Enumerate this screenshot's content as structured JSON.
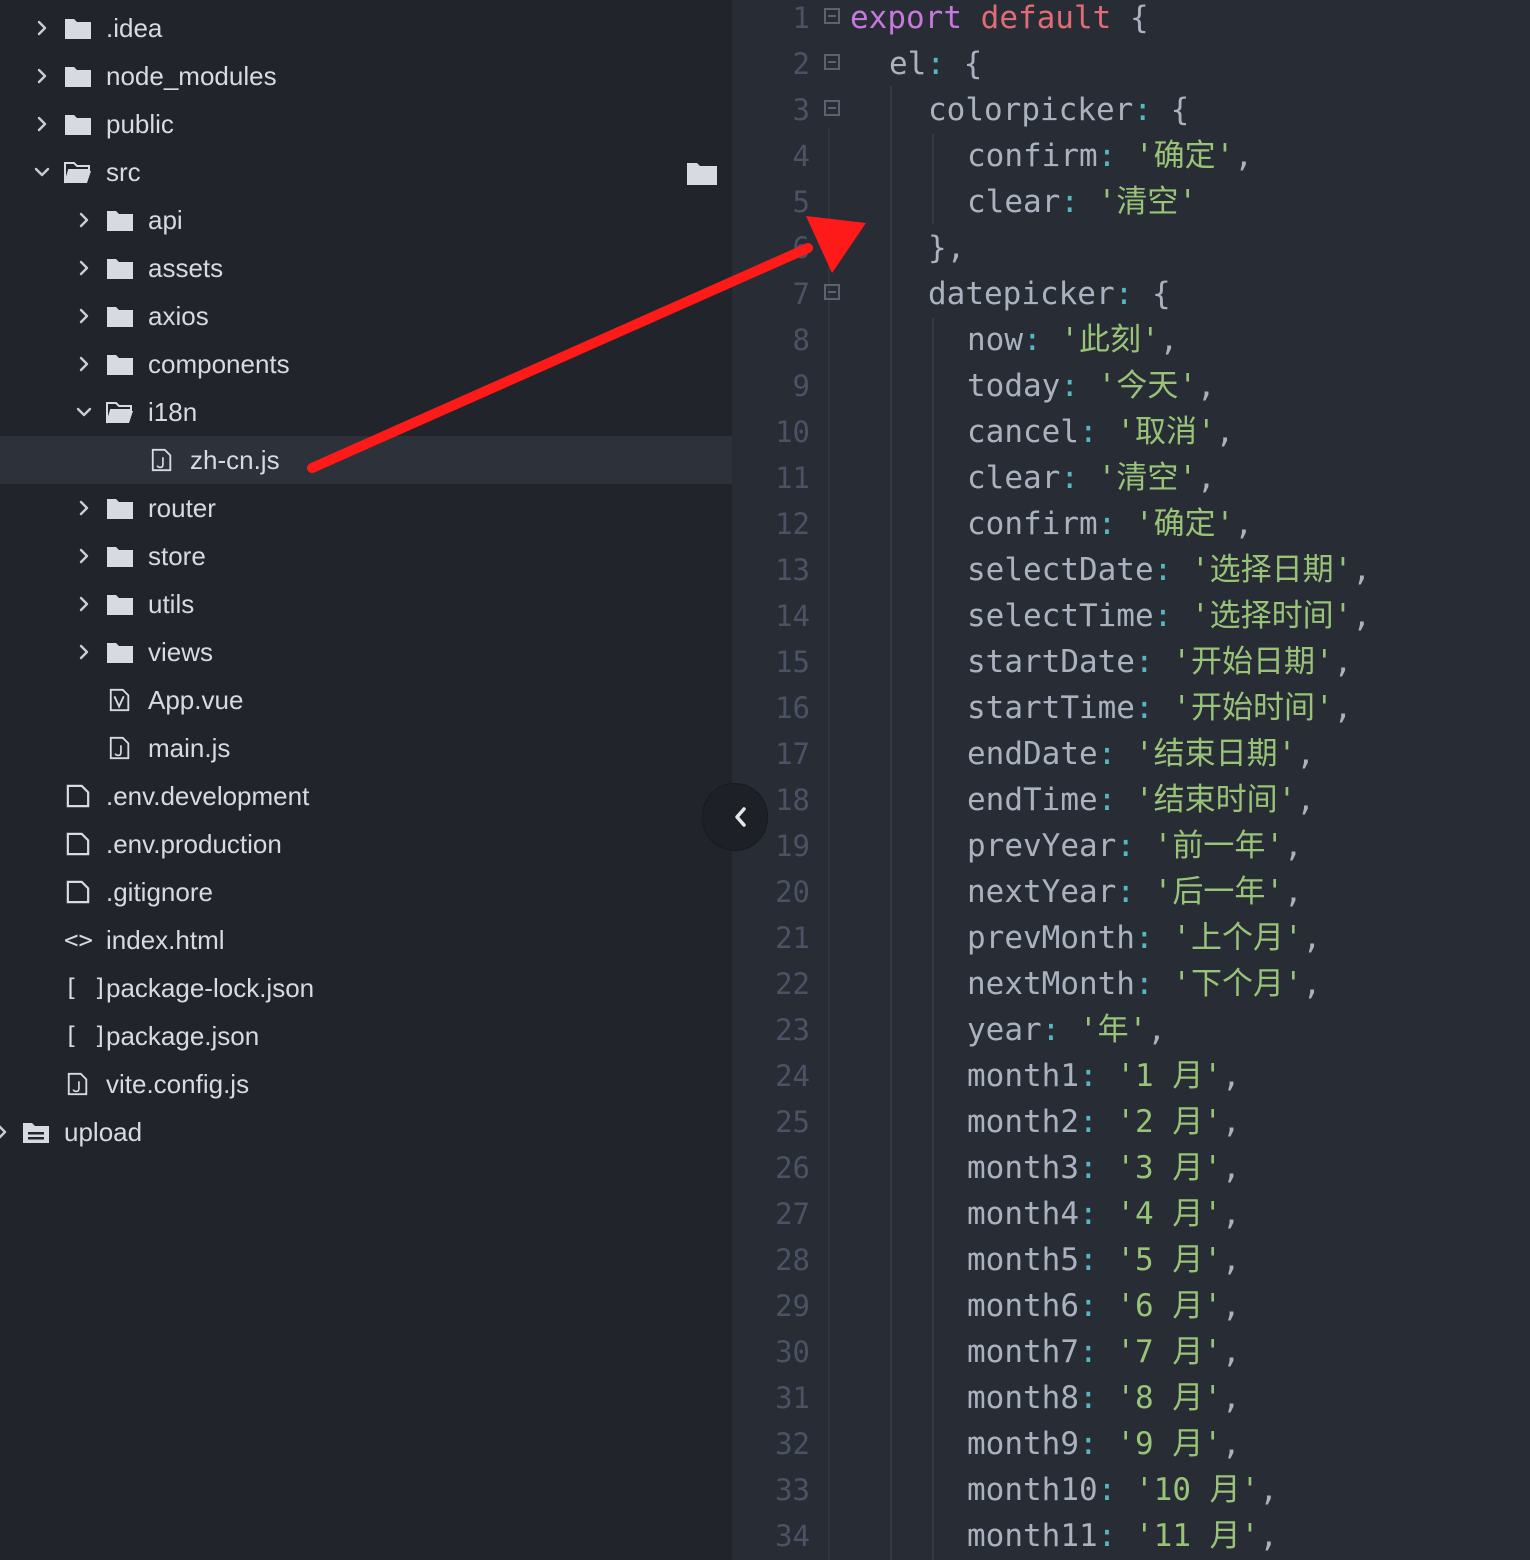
{
  "sidebar": {
    "items": [
      {
        "label": ".idea",
        "kind": "folder",
        "depth": 1,
        "expanded": false
      },
      {
        "label": "node_modules",
        "kind": "folder",
        "depth": 1,
        "expanded": false
      },
      {
        "label": "public",
        "kind": "folder",
        "depth": 1,
        "expanded": false
      },
      {
        "label": "src",
        "kind": "folder",
        "depth": 1,
        "expanded": true
      },
      {
        "label": "api",
        "kind": "folder",
        "depth": 2,
        "expanded": false
      },
      {
        "label": "assets",
        "kind": "folder",
        "depth": 2,
        "expanded": false
      },
      {
        "label": "axios",
        "kind": "folder",
        "depth": 2,
        "expanded": false
      },
      {
        "label": "components",
        "kind": "folder",
        "depth": 2,
        "expanded": false
      },
      {
        "label": "i18n",
        "kind": "folder",
        "depth": 2,
        "expanded": true
      },
      {
        "label": "zh-cn.js",
        "kind": "js-file",
        "depth": 3,
        "selected": true
      },
      {
        "label": "router",
        "kind": "folder",
        "depth": 2,
        "expanded": false
      },
      {
        "label": "store",
        "kind": "folder",
        "depth": 2,
        "expanded": false
      },
      {
        "label": "utils",
        "kind": "folder",
        "depth": 2,
        "expanded": false
      },
      {
        "label": "views",
        "kind": "folder",
        "depth": 2,
        "expanded": false
      },
      {
        "label": "App.vue",
        "kind": "vue-file",
        "depth": 2
      },
      {
        "label": "main.js",
        "kind": "js-file",
        "depth": 2
      },
      {
        "label": ".env.development",
        "kind": "file",
        "depth": 1
      },
      {
        "label": ".env.production",
        "kind": "file",
        "depth": 1
      },
      {
        "label": ".gitignore",
        "kind": "file",
        "depth": 1
      },
      {
        "label": "index.html",
        "kind": "html-file",
        "depth": 1,
        "symbol": "<>"
      },
      {
        "label": "package-lock.json",
        "kind": "json-file",
        "depth": 1,
        "symbol": "[ ]"
      },
      {
        "label": "package.json",
        "kind": "json-file",
        "depth": 1,
        "symbol": "[ ]"
      },
      {
        "label": "vite.config.js",
        "kind": "js-file",
        "depth": 1
      },
      {
        "label": "upload",
        "kind": "upload-folder",
        "depth": 0,
        "expanded": false
      }
    ]
  },
  "editor": {
    "lines": [
      {
        "n": "1",
        "fold": true,
        "indent": 0,
        "tokens": [
          [
            "kw",
            "export"
          ],
          [
            "p",
            " "
          ],
          [
            "def",
            "default"
          ],
          [
            "p",
            " {"
          ]
        ]
      },
      {
        "n": "2",
        "fold": true,
        "indent": 1,
        "tokens": [
          [
            "k",
            "el"
          ],
          [
            "c",
            ":"
          ],
          [
            "p",
            " {"
          ]
        ]
      },
      {
        "n": "3",
        "fold": true,
        "indent": 2,
        "tokens": [
          [
            "k",
            "colorpicker"
          ],
          [
            "c",
            ":"
          ],
          [
            "p",
            " {"
          ]
        ]
      },
      {
        "n": "4",
        "indent": 3,
        "tokens": [
          [
            "k",
            "confirm"
          ],
          [
            "c",
            ":"
          ],
          [
            "p",
            " "
          ],
          [
            "s",
            "'确定'"
          ],
          [
            "p",
            ","
          ]
        ]
      },
      {
        "n": "5",
        "indent": 3,
        "tokens": [
          [
            "k",
            "clear"
          ],
          [
            "c",
            ":"
          ],
          [
            "p",
            " "
          ],
          [
            "s",
            "'清空'"
          ]
        ]
      },
      {
        "n": "6",
        "indent": 2,
        "tokens": [
          [
            "p",
            "},"
          ]
        ]
      },
      {
        "n": "7",
        "fold": true,
        "indent": 2,
        "tokens": [
          [
            "k",
            "datepicker"
          ],
          [
            "c",
            ":"
          ],
          [
            "p",
            " {"
          ]
        ]
      },
      {
        "n": "8",
        "indent": 3,
        "tokens": [
          [
            "k",
            "now"
          ],
          [
            "c",
            ":"
          ],
          [
            "p",
            " "
          ],
          [
            "s",
            "'此刻'"
          ],
          [
            "p",
            ","
          ]
        ]
      },
      {
        "n": "9",
        "indent": 3,
        "tokens": [
          [
            "k",
            "today"
          ],
          [
            "c",
            ":"
          ],
          [
            "p",
            " "
          ],
          [
            "s",
            "'今天'"
          ],
          [
            "p",
            ","
          ]
        ]
      },
      {
        "n": "10",
        "indent": 3,
        "tokens": [
          [
            "k",
            "cancel"
          ],
          [
            "c",
            ":"
          ],
          [
            "p",
            " "
          ],
          [
            "s",
            "'取消'"
          ],
          [
            "p",
            ","
          ]
        ]
      },
      {
        "n": "11",
        "indent": 3,
        "tokens": [
          [
            "k",
            "clear"
          ],
          [
            "c",
            ":"
          ],
          [
            "p",
            " "
          ],
          [
            "s",
            "'清空'"
          ],
          [
            "p",
            ","
          ]
        ]
      },
      {
        "n": "12",
        "indent": 3,
        "tokens": [
          [
            "k",
            "confirm"
          ],
          [
            "c",
            ":"
          ],
          [
            "p",
            " "
          ],
          [
            "s",
            "'确定'"
          ],
          [
            "p",
            ","
          ]
        ]
      },
      {
        "n": "13",
        "indent": 3,
        "tokens": [
          [
            "k",
            "selectDate"
          ],
          [
            "c",
            ":"
          ],
          [
            "p",
            " "
          ],
          [
            "s",
            "'选择日期'"
          ],
          [
            "p",
            ","
          ]
        ]
      },
      {
        "n": "14",
        "indent": 3,
        "tokens": [
          [
            "k",
            "selectTime"
          ],
          [
            "c",
            ":"
          ],
          [
            "p",
            " "
          ],
          [
            "s",
            "'选择时间'"
          ],
          [
            "p",
            ","
          ]
        ]
      },
      {
        "n": "15",
        "indent": 3,
        "tokens": [
          [
            "k",
            "startDate"
          ],
          [
            "c",
            ":"
          ],
          [
            "p",
            " "
          ],
          [
            "s",
            "'开始日期'"
          ],
          [
            "p",
            ","
          ]
        ]
      },
      {
        "n": "16",
        "indent": 3,
        "tokens": [
          [
            "k",
            "startTime"
          ],
          [
            "c",
            ":"
          ],
          [
            "p",
            " "
          ],
          [
            "s",
            "'开始时间'"
          ],
          [
            "p",
            ","
          ]
        ]
      },
      {
        "n": "17",
        "indent": 3,
        "tokens": [
          [
            "k",
            "endDate"
          ],
          [
            "c",
            ":"
          ],
          [
            "p",
            " "
          ],
          [
            "s",
            "'结束日期'"
          ],
          [
            "p",
            ","
          ]
        ]
      },
      {
        "n": "18",
        "indent": 3,
        "tokens": [
          [
            "k",
            "endTime"
          ],
          [
            "c",
            ":"
          ],
          [
            "p",
            " "
          ],
          [
            "s",
            "'结束时间'"
          ],
          [
            "p",
            ","
          ]
        ]
      },
      {
        "n": "19",
        "indent": 3,
        "tokens": [
          [
            "k",
            "prevYear"
          ],
          [
            "c",
            ":"
          ],
          [
            "p",
            " "
          ],
          [
            "s",
            "'前一年'"
          ],
          [
            "p",
            ","
          ]
        ]
      },
      {
        "n": "20",
        "indent": 3,
        "tokens": [
          [
            "k",
            "nextYear"
          ],
          [
            "c",
            ":"
          ],
          [
            "p",
            " "
          ],
          [
            "s",
            "'后一年'"
          ],
          [
            "p",
            ","
          ]
        ]
      },
      {
        "n": "21",
        "indent": 3,
        "tokens": [
          [
            "k",
            "prevMonth"
          ],
          [
            "c",
            ":"
          ],
          [
            "p",
            " "
          ],
          [
            "s",
            "'上个月'"
          ],
          [
            "p",
            ","
          ]
        ]
      },
      {
        "n": "22",
        "indent": 3,
        "tokens": [
          [
            "k",
            "nextMonth"
          ],
          [
            "c",
            ":"
          ],
          [
            "p",
            " "
          ],
          [
            "s",
            "'下个月'"
          ],
          [
            "p",
            ","
          ]
        ]
      },
      {
        "n": "23",
        "indent": 3,
        "tokens": [
          [
            "k",
            "year"
          ],
          [
            "c",
            ":"
          ],
          [
            "p",
            " "
          ],
          [
            "s",
            "'年'"
          ],
          [
            "p",
            ","
          ]
        ]
      },
      {
        "n": "24",
        "indent": 3,
        "tokens": [
          [
            "k",
            "month1"
          ],
          [
            "c",
            ":"
          ],
          [
            "p",
            " "
          ],
          [
            "s",
            "'1 月'"
          ],
          [
            "p",
            ","
          ]
        ]
      },
      {
        "n": "25",
        "indent": 3,
        "tokens": [
          [
            "k",
            "month2"
          ],
          [
            "c",
            ":"
          ],
          [
            "p",
            " "
          ],
          [
            "s",
            "'2 月'"
          ],
          [
            "p",
            ","
          ]
        ]
      },
      {
        "n": "26",
        "indent": 3,
        "tokens": [
          [
            "k",
            "month3"
          ],
          [
            "c",
            ":"
          ],
          [
            "p",
            " "
          ],
          [
            "s",
            "'3 月'"
          ],
          [
            "p",
            ","
          ]
        ]
      },
      {
        "n": "27",
        "indent": 3,
        "tokens": [
          [
            "k",
            "month4"
          ],
          [
            "c",
            ":"
          ],
          [
            "p",
            " "
          ],
          [
            "s",
            "'4 月'"
          ],
          [
            "p",
            ","
          ]
        ]
      },
      {
        "n": "28",
        "indent": 3,
        "tokens": [
          [
            "k",
            "month5"
          ],
          [
            "c",
            ":"
          ],
          [
            "p",
            " "
          ],
          [
            "s",
            "'5 月'"
          ],
          [
            "p",
            ","
          ]
        ]
      },
      {
        "n": "29",
        "indent": 3,
        "tokens": [
          [
            "k",
            "month6"
          ],
          [
            "c",
            ":"
          ],
          [
            "p",
            " "
          ],
          [
            "s",
            "'6 月'"
          ],
          [
            "p",
            ","
          ]
        ]
      },
      {
        "n": "30",
        "indent": 3,
        "tokens": [
          [
            "k",
            "month7"
          ],
          [
            "c",
            ":"
          ],
          [
            "p",
            " "
          ],
          [
            "s",
            "'7 月'"
          ],
          [
            "p",
            ","
          ]
        ]
      },
      {
        "n": "31",
        "indent": 3,
        "tokens": [
          [
            "k",
            "month8"
          ],
          [
            "c",
            ":"
          ],
          [
            "p",
            " "
          ],
          [
            "s",
            "'8 月'"
          ],
          [
            "p",
            ","
          ]
        ]
      },
      {
        "n": "32",
        "indent": 3,
        "tokens": [
          [
            "k",
            "month9"
          ],
          [
            "c",
            ":"
          ],
          [
            "p",
            " "
          ],
          [
            "s",
            "'9 月'"
          ],
          [
            "p",
            ","
          ]
        ]
      },
      {
        "n": "33",
        "indent": 3,
        "tokens": [
          [
            "k",
            "month10"
          ],
          [
            "c",
            ":"
          ],
          [
            "p",
            " "
          ],
          [
            "s",
            "'10 月'"
          ],
          [
            "p",
            ","
          ]
        ]
      },
      {
        "n": "34",
        "indent": 3,
        "tokens": [
          [
            "k",
            "month11"
          ],
          [
            "c",
            ":"
          ],
          [
            "p",
            " "
          ],
          [
            "s",
            "'11 月'"
          ],
          [
            "p",
            ","
          ]
        ]
      }
    ]
  },
  "colors": {
    "sidebar_bg": "#21252b",
    "editor_bg": "#282c34",
    "selection": "#2c313a",
    "keyword": "#c678dd",
    "default_kw": "#e06c75",
    "string": "#98c379",
    "annotation_arrow": "#ff1a1a"
  },
  "icons": {
    "folder": "folder-icon",
    "open_folder": "folder-open-icon",
    "file": "file-icon",
    "js_file": "js-file-icon",
    "vue_file": "vue-file-icon",
    "collapse": "chevron-left-icon",
    "new_folder": "new-folder-icon"
  }
}
